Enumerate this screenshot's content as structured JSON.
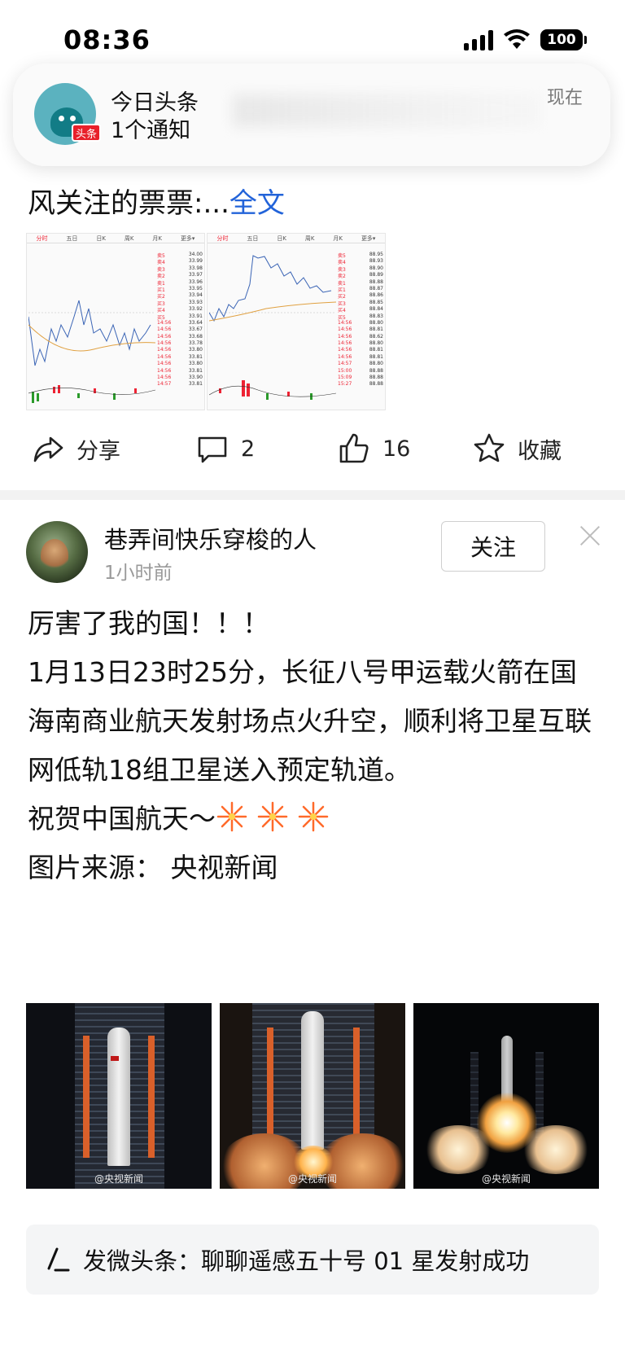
{
  "status_bar": {
    "time": "08:36",
    "battery": "100"
  },
  "notification": {
    "app_name": "今日头条",
    "summary": "1个通知",
    "time": "现在",
    "badge": "头条"
  },
  "article1": {
    "text_tail": "风关注的票票:...",
    "full_text_link": "全文",
    "stock_tabs": [
      "分时",
      "五日",
      "日K",
      "周K",
      "月K",
      "更多▾"
    ]
  },
  "actions": {
    "share": "分享",
    "comments": "2",
    "likes": "16",
    "favorite": "收藏"
  },
  "post2": {
    "author": "巷弄间快乐穿梭的人",
    "time": "1小时前",
    "follow": "关注",
    "lines": [
      "厉害了我的国！！！",
      "1月13日23时25分，长征八号甲运载火箭在国海南商业航天发射场点火升空，顺利将卫星互联网低轨18组卫星送入预定轨道。",
      "祝贺中国航天～",
      "图片来源： 央视新闻"
    ],
    "photo_watermark": "@央视新闻"
  },
  "topic_card": {
    "text": "发微头条：聊聊遥感五十号 01 星发射成功"
  }
}
